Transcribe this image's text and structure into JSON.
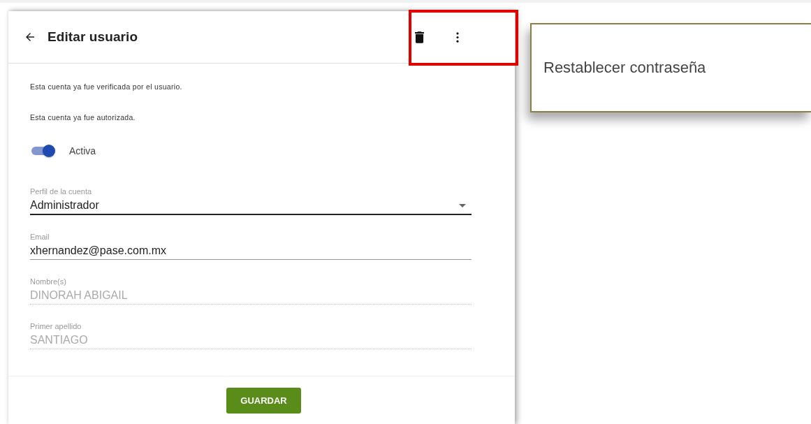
{
  "dialog": {
    "title": "Editar usuario",
    "actions_highlighted": true,
    "messages": [
      "Esta cuenta ya fue verificada por el usuario.",
      "Esta cuenta ya fue autorizada."
    ],
    "toggle": {
      "label": "Activa",
      "on": true
    },
    "fields": [
      {
        "kind": "select",
        "label": "Perfil de la cuenta",
        "value": "Administrador",
        "disabled": false
      },
      {
        "kind": "text",
        "label": "Email",
        "value": "xhernandez@pase.com.mx",
        "disabled": false
      },
      {
        "kind": "text",
        "label": "Nombre(s)",
        "value": "DINORAH ABIGAIL",
        "disabled": true
      },
      {
        "kind": "text",
        "label": "Primer apellido",
        "value": "SANTIAGO",
        "disabled": true
      }
    ],
    "save_button": "GUARDAR"
  },
  "menu": {
    "items": [
      "Restablecer contraseña"
    ]
  }
}
